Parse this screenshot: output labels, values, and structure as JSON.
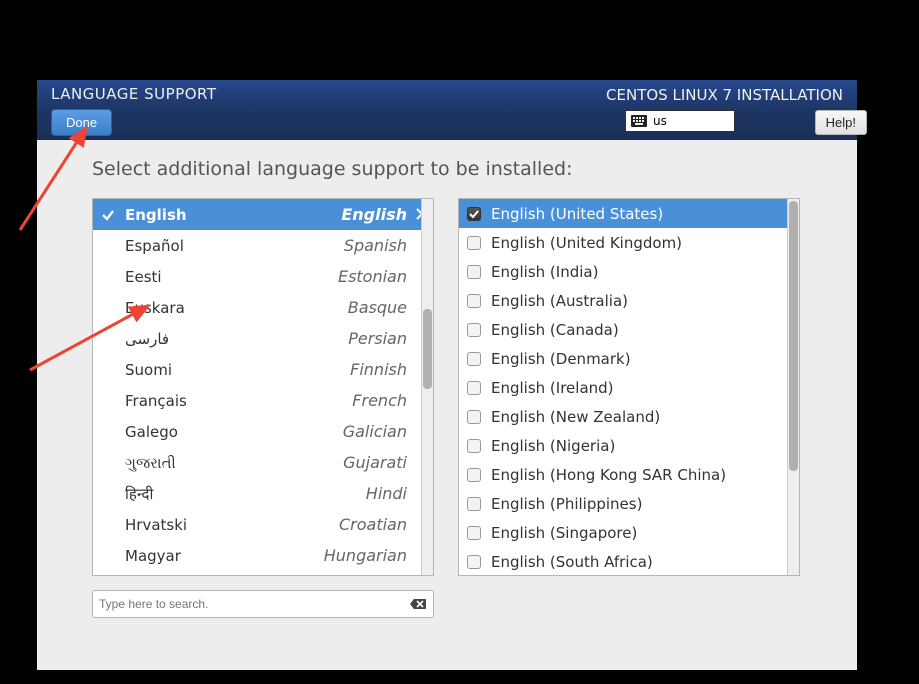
{
  "header": {
    "title": "LANGUAGE SUPPORT",
    "done_label": "Done",
    "distro": "CENTOS LINUX 7 INSTALLATION",
    "kb_layout": "us",
    "help_label": "Help!"
  },
  "instruction": "Select additional language support to be installed:",
  "search": {
    "placeholder": "Type here to search."
  },
  "languages": [
    {
      "native": "English",
      "english": "English",
      "selected": true,
      "checked": true
    },
    {
      "native": "Español",
      "english": "Spanish",
      "selected": false,
      "checked": false
    },
    {
      "native": "Eesti",
      "english": "Estonian",
      "selected": false,
      "checked": false
    },
    {
      "native": "Euskara",
      "english": "Basque",
      "selected": false,
      "checked": false
    },
    {
      "native": "فارسی",
      "english": "Persian",
      "selected": false,
      "checked": false
    },
    {
      "native": "Suomi",
      "english": "Finnish",
      "selected": false,
      "checked": false
    },
    {
      "native": "Français",
      "english": "French",
      "selected": false,
      "checked": false
    },
    {
      "native": "Galego",
      "english": "Galician",
      "selected": false,
      "checked": false
    },
    {
      "native": "ગુજરાતી",
      "english": "Gujarati",
      "selected": false,
      "checked": false
    },
    {
      "native": "हिन्दी",
      "english": "Hindi",
      "selected": false,
      "checked": false
    },
    {
      "native": "Hrvatski",
      "english": "Croatian",
      "selected": false,
      "checked": false
    },
    {
      "native": "Magyar",
      "english": "Hungarian",
      "selected": false,
      "checked": false
    }
  ],
  "locales": [
    {
      "label": "English (United States)",
      "checked": true,
      "selected": true
    },
    {
      "label": "English (United Kingdom)",
      "checked": false,
      "selected": false
    },
    {
      "label": "English (India)",
      "checked": false,
      "selected": false
    },
    {
      "label": "English (Australia)",
      "checked": false,
      "selected": false
    },
    {
      "label": "English (Canada)",
      "checked": false,
      "selected": false
    },
    {
      "label": "English (Denmark)",
      "checked": false,
      "selected": false
    },
    {
      "label": "English (Ireland)",
      "checked": false,
      "selected": false
    },
    {
      "label": "English (New Zealand)",
      "checked": false,
      "selected": false
    },
    {
      "label": "English (Nigeria)",
      "checked": false,
      "selected": false
    },
    {
      "label": "English (Hong Kong SAR China)",
      "checked": false,
      "selected": false
    },
    {
      "label": "English (Philippines)",
      "checked": false,
      "selected": false
    },
    {
      "label": "English (Singapore)",
      "checked": false,
      "selected": false
    },
    {
      "label": "English (South Africa)",
      "checked": false,
      "selected": false
    }
  ]
}
